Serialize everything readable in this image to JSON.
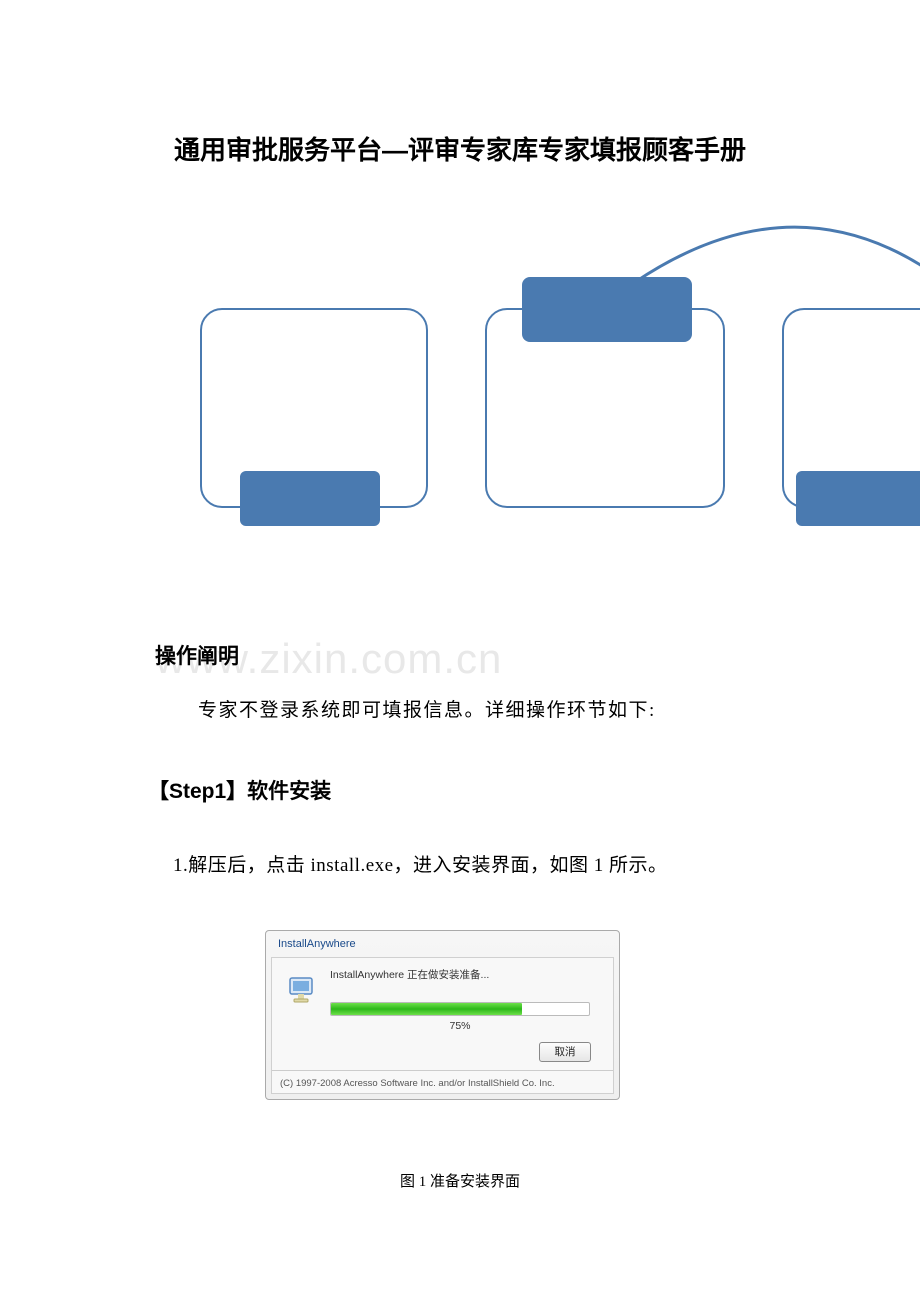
{
  "title": "通用审批服务平台—评审专家库专家填报顾客手册",
  "watermark": "www.zixin.com.cn",
  "sections": {
    "operation": {
      "heading": "操作阐明",
      "body": "专家不登录系统即可填报信息。详细操作环节如下:"
    },
    "step1": {
      "heading": "【Step1】软件安装",
      "body": "1.解压后，点击 install.exe，进入安装界面，如图 1 所示。"
    }
  },
  "installer": {
    "window_title": "InstallAnywhere",
    "status_text": "InstallAnywhere 正在做安装准备...",
    "progress_percent": "75%",
    "cancel_label": "取消",
    "copyright": "(C) 1997-2008 Acresso Software Inc. and/or InstallShield Co. Inc."
  },
  "figure_caption": "图 1 准备安装界面",
  "diagram": {
    "colors": {
      "stroke": "#4a7ab0",
      "fill": "#4a7ab0"
    }
  }
}
